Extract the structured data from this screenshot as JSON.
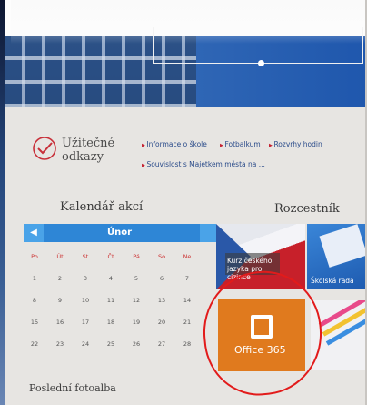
{
  "useful_links": {
    "title": "Užitečné odkazy",
    "links": [
      "Informace o škole",
      "Fotbalkum",
      "Rozvrhy hodin",
      "Souvislost s Majetkem města na ...",
      "..."
    ]
  },
  "calendar": {
    "title": "Kalendář akcí",
    "month": "Únor",
    "prev_label": "◀",
    "weekdays": [
      "Po",
      "Út",
      "St",
      "Čt",
      "Pá",
      "So",
      "Ne"
    ],
    "weeks": [
      [
        "1",
        "2",
        "3",
        "4",
        "5",
        "6",
        "7"
      ],
      [
        "8",
        "9",
        "10",
        "11",
        "12",
        "13",
        "14"
      ],
      [
        "15",
        "16",
        "17",
        "18",
        "19",
        "20",
        "21"
      ],
      [
        "22",
        "23",
        "24",
        "25",
        "26",
        "27",
        "28"
      ]
    ]
  },
  "crossroads": {
    "title": "Rozcestník",
    "tiles": {
      "czech_course": "Kurz českého jazyka pro cizince",
      "school_info": "Školská rada",
      "office": "Office 365"
    }
  },
  "photo_albums": {
    "title": "Poslední fotoalba"
  },
  "colors": {
    "calendar_blue": "#2e86d6",
    "office_orange": "#e07a1e",
    "annotation_red": "#e21b1b",
    "link_blue": "#2a4b8a"
  },
  "icons": [
    "check-circle-icon",
    "office-logo-icon",
    "chevron-left-icon"
  ]
}
